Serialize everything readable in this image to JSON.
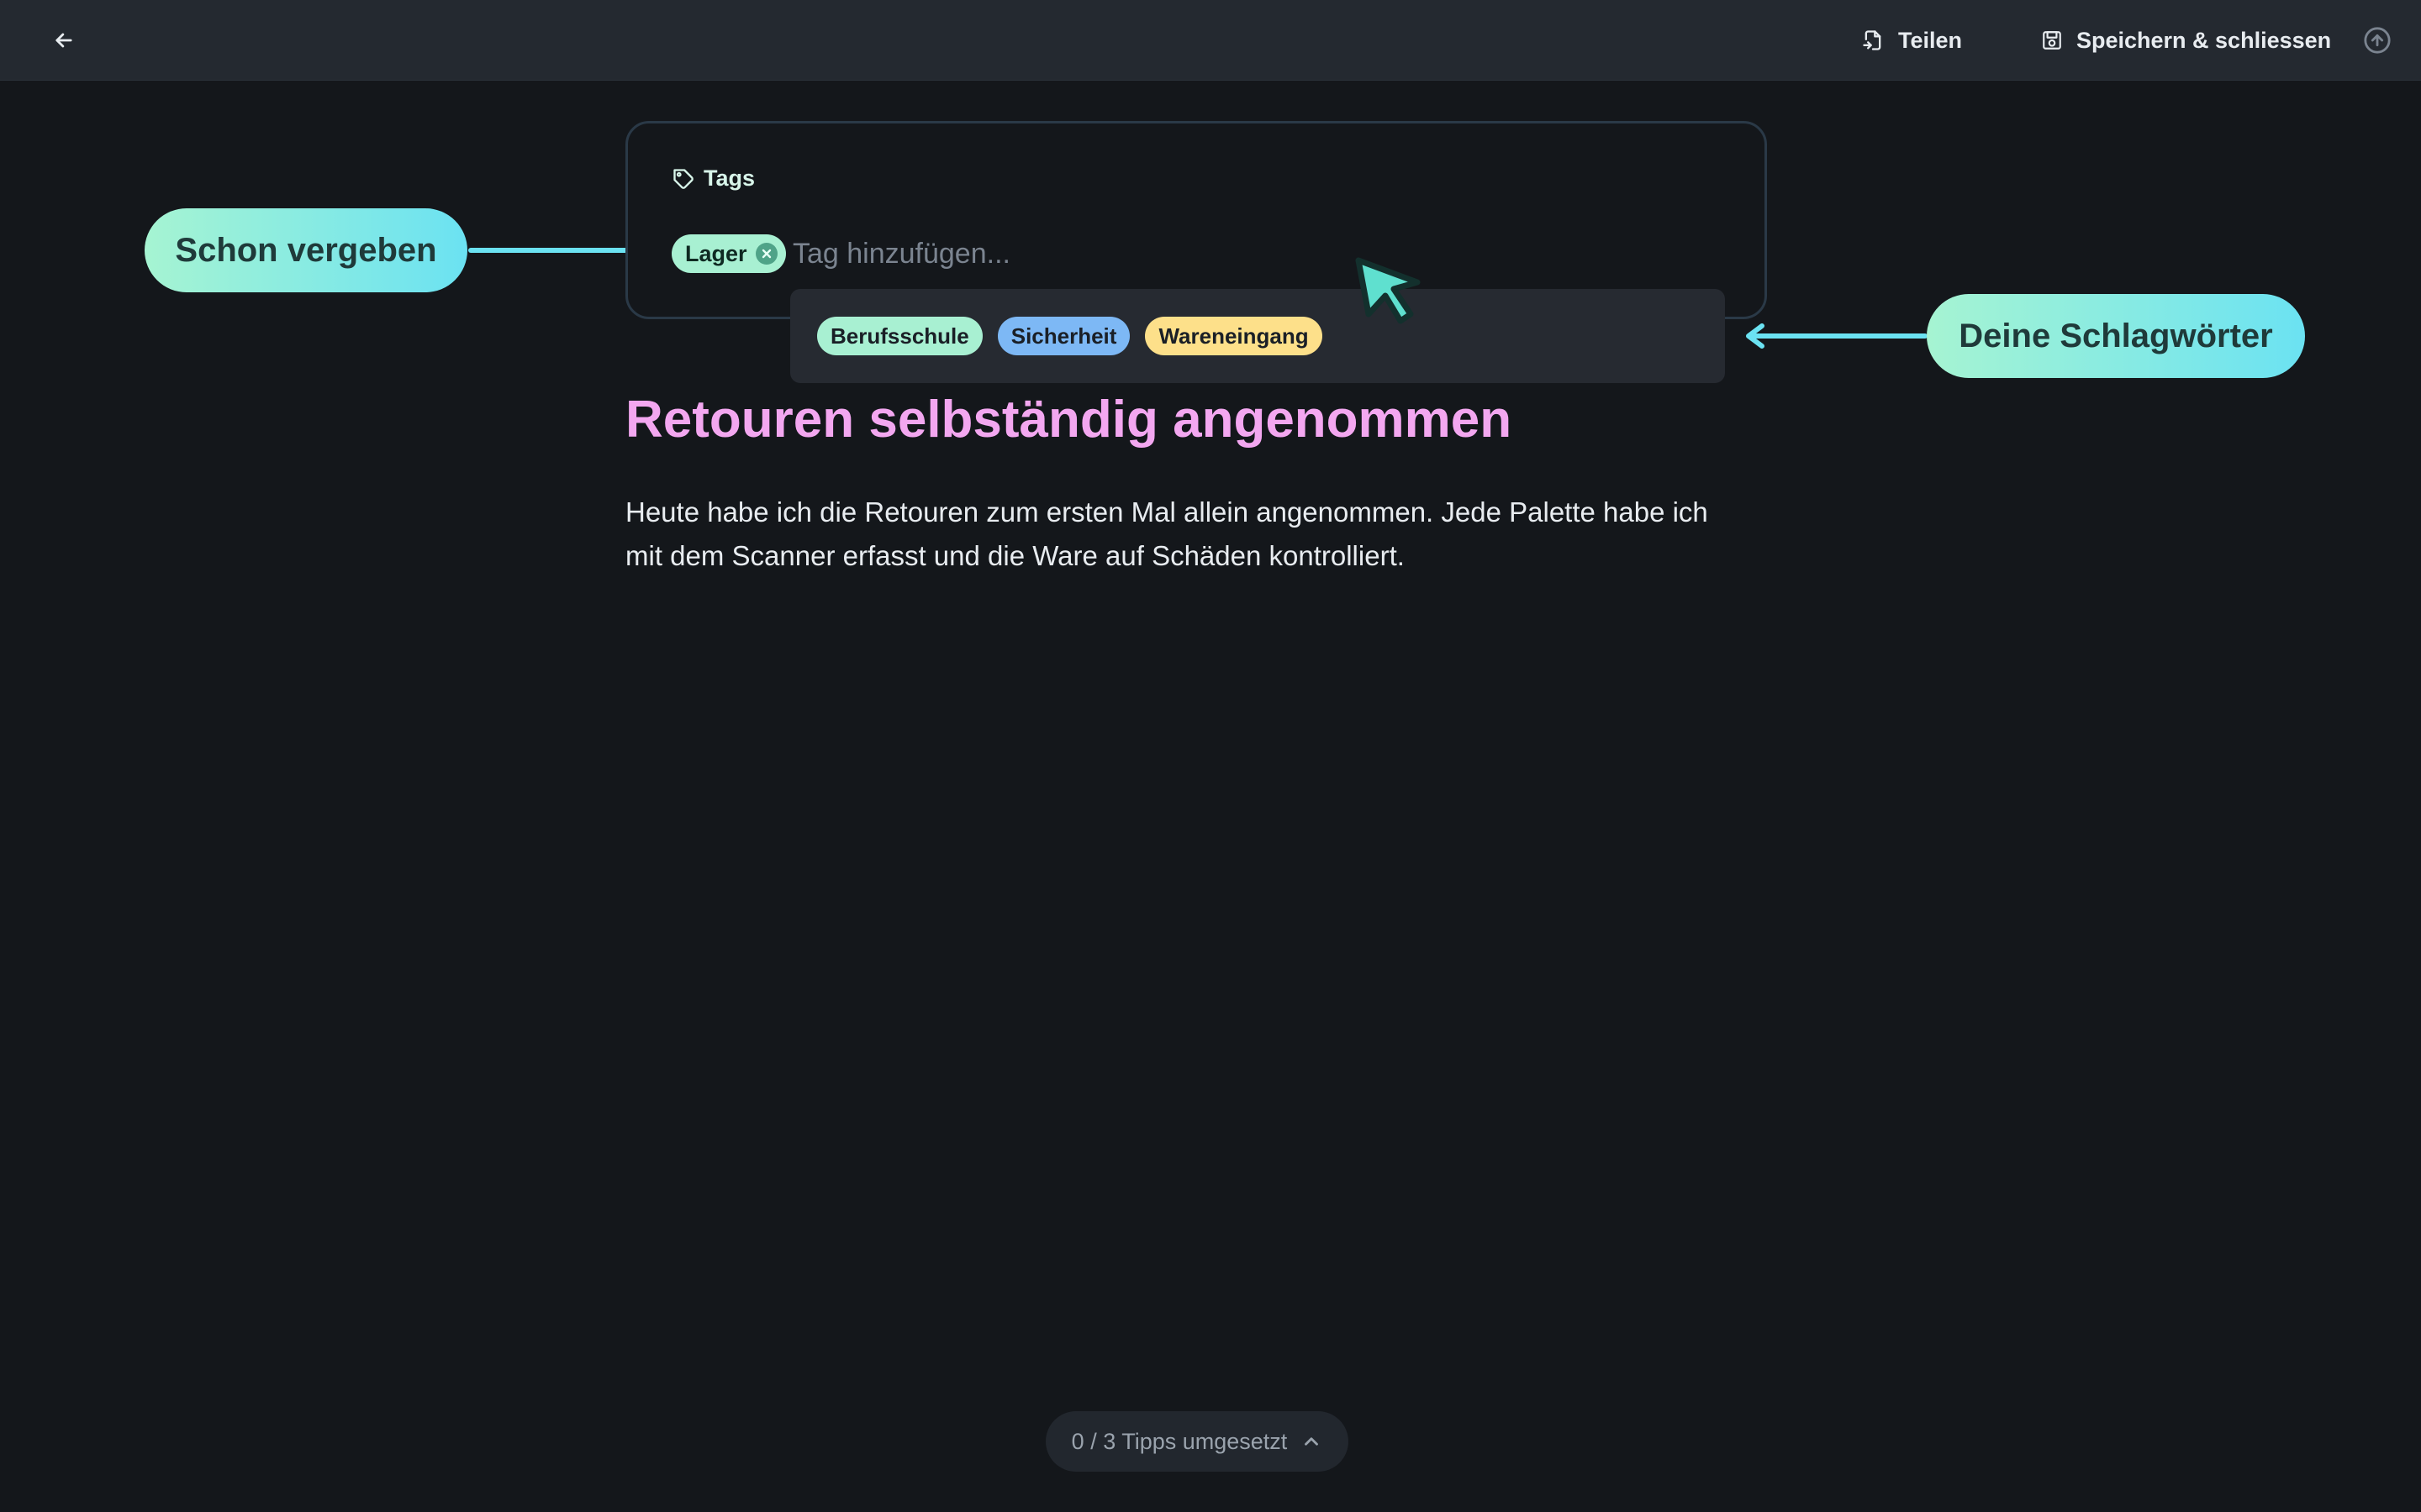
{
  "topbar": {
    "back_icon": "arrow-left-icon",
    "share_label": "Teilen",
    "share_icon": "share-file-icon",
    "save_label": "Speichern & schliessen",
    "save_icon": "save-disk-icon",
    "upload_icon": "arrow-up-circle-icon"
  },
  "tags": {
    "label": "Tags",
    "label_icon": "tag-icon",
    "assigned": [
      {
        "label": "Lager",
        "color": "#a8f0d2"
      }
    ],
    "input_placeholder": "Tag hinzufügen...",
    "suggestions": [
      {
        "label": "Berufsschule",
        "color": "#a8f0d2"
      },
      {
        "label": "Sicherheit",
        "color": "#7db8f5"
      },
      {
        "label": "Wareneingang",
        "color": "#fde08a"
      }
    ]
  },
  "callouts": {
    "left": "Schon vergeben",
    "right": "Deine Schlagwörter"
  },
  "entry": {
    "title": "Retouren selbständig angenommen",
    "body": "Heute habe ich die Retouren zum ersten Mal allein angenommen. Jede Palette habe ich mit dem Scanner erfasst und die Ware auf Schäden kontrolliert."
  },
  "tips": {
    "label": "0 / 3 Tipps umgesetzt",
    "icon": "chevron-up-icon"
  },
  "colors": {
    "accent_teal": "#6be2f2",
    "title_pink": "#f3a7f0",
    "background": "#14171b"
  }
}
